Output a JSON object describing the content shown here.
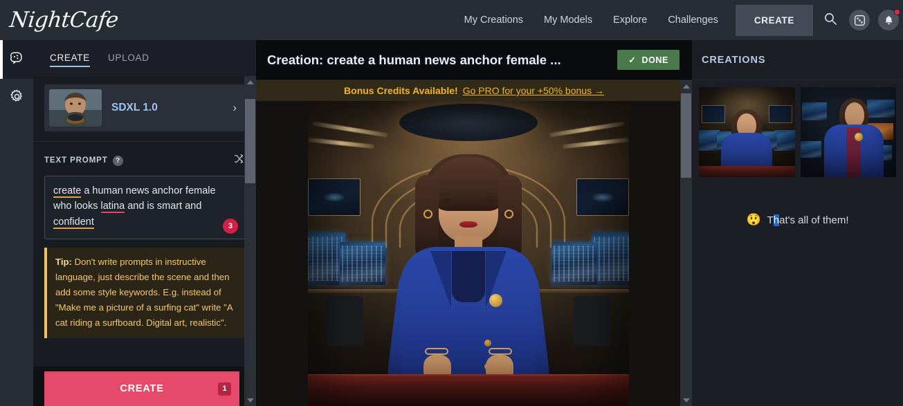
{
  "brand": {
    "logo_text": "NightCafe"
  },
  "topnav": {
    "links": [
      {
        "label": "My Creations",
        "name": "my-creations"
      },
      {
        "label": "My Models",
        "name": "my-models"
      },
      {
        "label": "Explore",
        "name": "explore"
      },
      {
        "label": "Challenges",
        "name": "challenges"
      }
    ],
    "create_label": "CREATE",
    "icons": [
      {
        "name": "search-icon",
        "label": "search"
      },
      {
        "name": "dice-icon",
        "label": "random"
      },
      {
        "name": "bell-icon",
        "label": "notifications",
        "has_badge": true
      }
    ]
  },
  "rail": {
    "items": [
      {
        "name": "brain-icon",
        "label": "Create",
        "active": true
      },
      {
        "name": "gear-icon",
        "label": "Settings",
        "active": false
      }
    ]
  },
  "left_panel": {
    "tabs": [
      {
        "label": "CREATE",
        "active": true
      },
      {
        "label": "UPLOAD",
        "active": false
      }
    ],
    "model": {
      "name": "SDXL 1.0",
      "chevron": "›"
    },
    "prompt": {
      "label": "TEXT PROMPT",
      "help": "?",
      "shuffle_icon": "shuffle-icon",
      "text_parts": [
        {
          "text": "create",
          "underline": "orange"
        },
        {
          "text": " a human news anchor female who looks ",
          "underline": "none"
        },
        {
          "text": "latina",
          "underline": "red"
        },
        {
          "text": " and is smart and ",
          "underline": "none"
        },
        {
          "text": "confident",
          "underline": "orange"
        }
      ],
      "full_text": "create a human news anchor female who looks latina and is smart and confident",
      "count_badge": "3"
    },
    "tip": {
      "prefix": "Tip:",
      "body": " Don't write prompts in instructive language, just describe the scene and then add some style keywords. E.g. instead of \"Make me a picture of a surfing cat\" write \"A cat riding a surfboard. Digital art, realistic\"."
    },
    "create_button": {
      "label": "CREATE",
      "badge": "1"
    }
  },
  "center": {
    "title": "Creation: create a human news anchor female ...",
    "done_button": {
      "label": "DONE",
      "check": "✓"
    },
    "banner": {
      "strong": "Bonus Credits Available!",
      "link": "Go PRO for your +50% bonus →"
    },
    "image_alt": "Generated image: smiling latina news anchor in blue blazer at a futuristic news studio desk"
  },
  "right_panel": {
    "title": "CREATIONS",
    "thumbnails": [
      {
        "alt": "news anchor smiling, blue blazer, studio wide shot"
      },
      {
        "alt": "news anchor three-quarter view, blue blazer, maroon blouse"
      }
    ],
    "end_message": {
      "emoji": "😲",
      "selected_prefix": "T",
      "selected_char": "h",
      "rest": "at's all of them!",
      "full": "That's all of them!"
    }
  },
  "colors": {
    "accent_pink": "#e54a6b",
    "accent_blue": "#9fc3ef",
    "banner_gold": "#f0b429",
    "done_green": "#4a7a4c",
    "badge_red": "#d11f45",
    "topbar_bg": "#272c35",
    "panel_bg": "#181b21",
    "center_bg": "#0a0b0e"
  }
}
